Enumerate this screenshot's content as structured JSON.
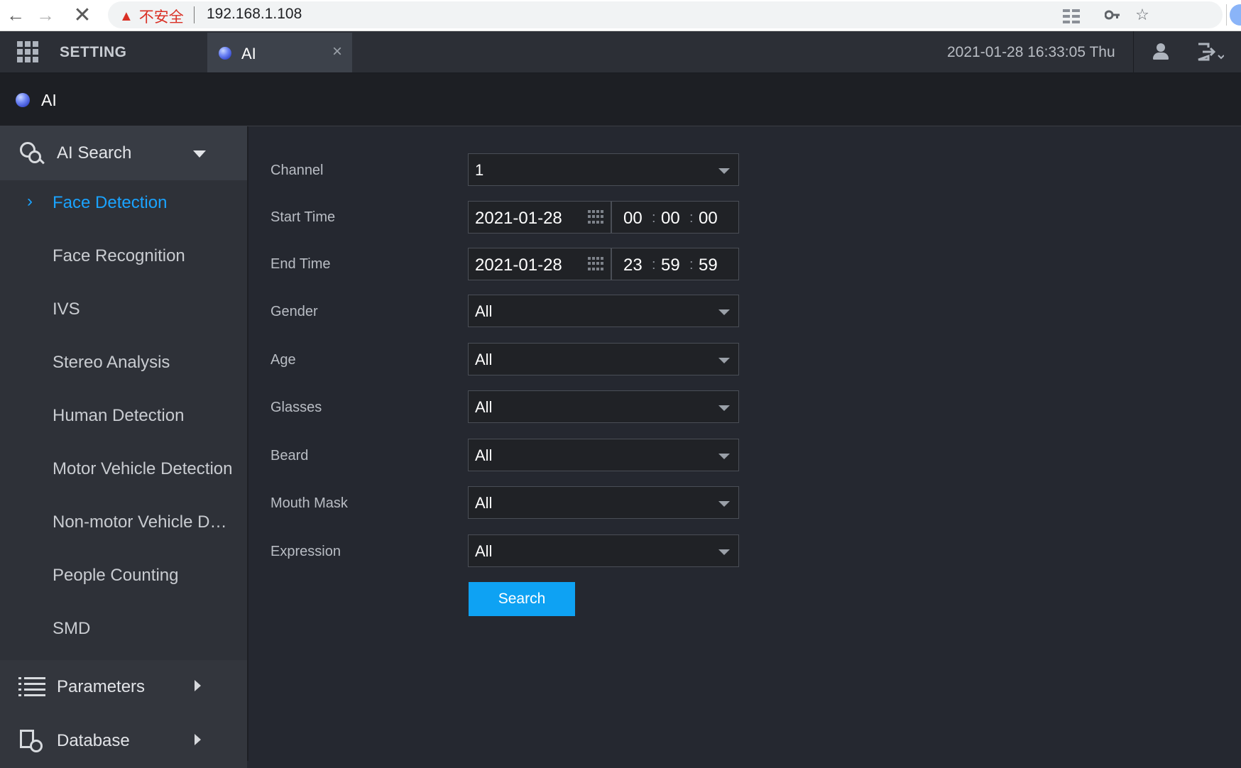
{
  "browser": {
    "security_warning": "不安全",
    "url": "192.168.1.108"
  },
  "topbar": {
    "setting_label": "SETTING",
    "active_tab_label": "AI",
    "close_symbol": "×",
    "datetime": "2021-01-28 16:33:05 Thu"
  },
  "page": {
    "title": "AI"
  },
  "sidebar": {
    "ai_search_label": "AI Search",
    "items": [
      {
        "label": "Face Detection",
        "active": true
      },
      {
        "label": "Face Recognition",
        "active": false
      },
      {
        "label": "IVS",
        "active": false
      },
      {
        "label": "Stereo Analysis",
        "active": false
      },
      {
        "label": "Human Detection",
        "active": false
      },
      {
        "label": "Motor Vehicle Detection",
        "active": false
      },
      {
        "label": "Non-motor Vehicle Detection",
        "active": false
      },
      {
        "label": "People Counting",
        "active": false
      },
      {
        "label": "SMD",
        "active": false
      }
    ],
    "parameters_label": "Parameters",
    "database_label": "Database"
  },
  "form": {
    "channel": {
      "label": "Channel",
      "value": "1"
    },
    "start_time": {
      "label": "Start Time",
      "date": "2021-01-28",
      "hh": "00",
      "mm": "00",
      "ss": "00"
    },
    "end_time": {
      "label": "End Time",
      "date": "2021-01-28",
      "hh": "23",
      "mm": "59",
      "ss": "59"
    },
    "gender": {
      "label": "Gender",
      "value": "All"
    },
    "age": {
      "label": "Age",
      "value": "All"
    },
    "glasses": {
      "label": "Glasses",
      "value": "All"
    },
    "beard": {
      "label": "Beard",
      "value": "All"
    },
    "mouth_mask": {
      "label": "Mouth Mask",
      "value": "All"
    },
    "expression": {
      "label": "Expression",
      "value": "All"
    },
    "time_separator": ":",
    "search_label": "Search"
  },
  "colors": {
    "accent": "#1aa3ff",
    "button": "#0ea2f3",
    "background": "#252830",
    "sidebar": "#2e3138",
    "warning": "#d93025"
  },
  "icons": {
    "back": "arrow-left-icon",
    "forward": "arrow-right-icon",
    "stop": "close-icon",
    "warning": "warning-triangle-icon",
    "key": "key-icon",
    "bookmark": "star-icon",
    "extensions": "grid-icon",
    "menu": "grid-menu-icon",
    "ai": "ai-orb-icon",
    "user": "user-icon",
    "logout": "logout-icon",
    "search": "ai-search-icon",
    "list": "list-icon",
    "database": "database-icon",
    "calendar": "calendar-icon"
  }
}
